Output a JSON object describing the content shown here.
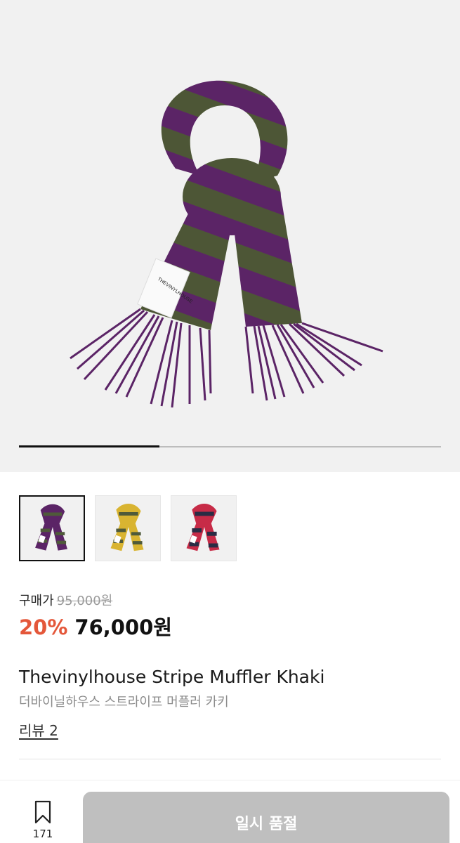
{
  "gallery": {
    "progress_fraction": 0.333,
    "label_text": "THEVINYLHOUSE",
    "thumbnails": [
      {
        "colorway": "purple-khaki",
        "primary": "#5b2466",
        "secondary": "#4f5a3a",
        "selected": true
      },
      {
        "colorway": "yellow-khaki",
        "primary": "#d9b431",
        "secondary": "#4f5a3a",
        "selected": false
      },
      {
        "colorway": "red-navy",
        "primary": "#c72b47",
        "secondary": "#2a2c44",
        "selected": false
      }
    ]
  },
  "pricing": {
    "label": "구매가",
    "original_price": "95,000원",
    "discount": "20%",
    "price": "76,000원",
    "accent_color": "#e4573a"
  },
  "product": {
    "name_en": "Thevinylhouse Stripe Muffler Khaki",
    "name_ko": "더바이닐하우스 스트라이프 머플러 카키",
    "review_link": "리뷰 2"
  },
  "bottom_bar": {
    "wishlist_icon": "bookmark-icon",
    "wishlist_count": "171",
    "action_label": "일시 품절"
  }
}
